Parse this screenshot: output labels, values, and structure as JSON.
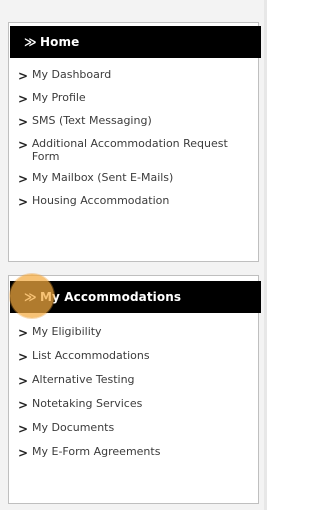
{
  "sections": [
    {
      "title": "Home",
      "items": [
        "My Dashboard",
        "My Profile",
        "SMS (Text Messaging)",
        "Additional Accommodation Request Form",
        "My Mailbox (Sent E-Mails)",
        "Housing Accommodation"
      ]
    },
    {
      "title": "My Accommodations",
      "items": [
        "My Eligibility",
        "List Accommodations",
        "Alternative Testing",
        "Notetaking Services",
        "My Documents",
        "My E-Form Agreements"
      ]
    }
  ],
  "icons": {
    "section_toggle": "double-chevron-down-icon",
    "menu_item": "chevron-right-icon"
  },
  "colors": {
    "header_bg": "#000000",
    "header_text": "#ffffff",
    "panel_bg": "#ffffff",
    "page_bg": "#f3f3f3",
    "highlight": "#f4aa40"
  }
}
